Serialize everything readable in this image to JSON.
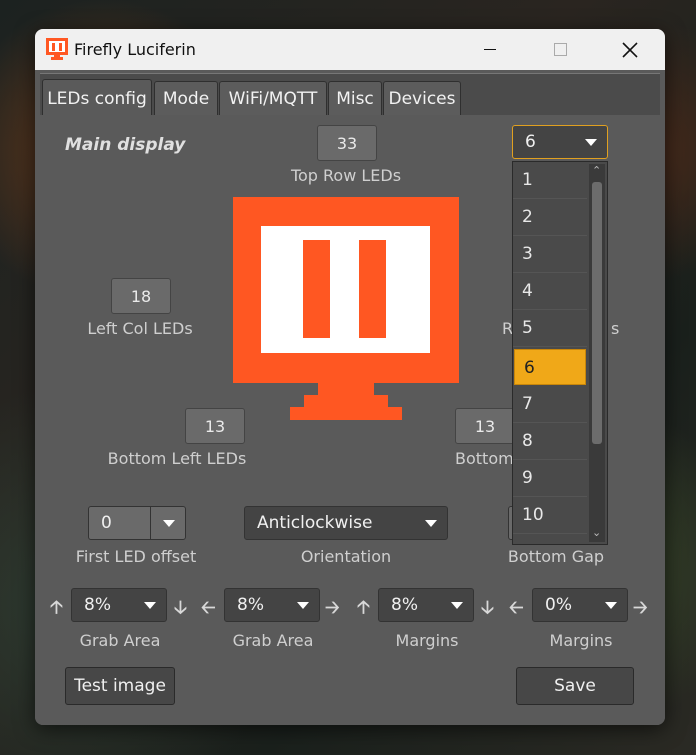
{
  "window": {
    "title": "Firefly Luciferin",
    "min_icon": "minimize-icon",
    "max_icon": "maximize-icon",
    "close_icon": "close-icon"
  },
  "tabs": [
    "LEDs config",
    "Mode",
    "WiFi/MQTT",
    "Misc",
    "Devices"
  ],
  "display_label": "Main display",
  "top_row": {
    "value": "33",
    "label": "Top Row LEDs"
  },
  "left_col": {
    "value": "18",
    "label": "Left Col LEDs"
  },
  "right_col": {
    "label_partial_1": "R",
    "label_partial_2": "s"
  },
  "bottom_left": {
    "value": "13",
    "label": "Bottom Left LEDs"
  },
  "bottom_right": {
    "value": "13",
    "label_partial": "Bottom"
  },
  "monitor_select": {
    "value": "6",
    "options": [
      "1",
      "2",
      "3",
      "4",
      "5",
      "6",
      "7",
      "8",
      "9",
      "10"
    ],
    "selected": "6"
  },
  "first_led_offset": {
    "value": "0",
    "label": "First LED offset"
  },
  "orientation": {
    "value": "Anticlockwise",
    "label": "Orientation"
  },
  "bottom_gap": {
    "label": "Bottom Gap"
  },
  "grab_row": [
    {
      "value": "8%",
      "label": "Grab Area",
      "left_icon": "arrow-up-icon",
      "right_icon": "arrow-down-icon"
    },
    {
      "value": "8%",
      "label": "Grab Area",
      "left_icon": "arrow-left-icon",
      "right_icon": "arrow-right-icon"
    },
    {
      "value": "8%",
      "label": "Margins",
      "left_icon": "arrow-up-icon",
      "right_icon": "arrow-down-icon"
    },
    {
      "value": "0%",
      "label": "Margins",
      "left_icon": "arrow-left-icon",
      "right_icon": "arrow-right-icon"
    }
  ],
  "buttons": {
    "test_image": "Test image",
    "save": "Save"
  },
  "colors": {
    "accent": "#ff5722",
    "selection": "#f0a818",
    "panel": "#5a5a5a"
  }
}
